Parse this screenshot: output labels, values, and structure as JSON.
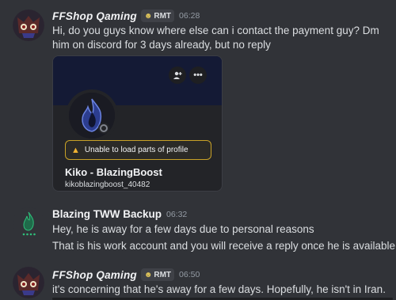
{
  "messages": [
    {
      "username": "FFShop Qaming",
      "tag": "RMT",
      "tag_icon": "emoji-icon",
      "time": "06:28",
      "lines": [
        "Hi, do you guys know where else can i contact the payment guy? Dm",
        "him on discord for 3 days already, but no reply"
      ]
    },
    {
      "username": "Blazing TWW Backup",
      "time": "06:32",
      "lines": [
        "Hey, he is away for a few days due to personal reasons",
        "That is his work account and you will receive a reply once he is available"
      ]
    },
    {
      "username": "FFShop Qaming",
      "tag": "RMT",
      "time": "06:50",
      "lines": [
        "it's concerning that he's away for a few days. Hopefully, he isn't in Iran."
      ]
    }
  ],
  "profile_card": {
    "warning": "Unable to load parts of profile",
    "display_name": "Kiko - BlazingBoost",
    "username": "kikoblazingboost_40482",
    "status": "offline",
    "banner_color": "#141a35",
    "add_friend_icon": "add-friend-icon",
    "more_icon": "more-options-icon",
    "more_glyph": "•••"
  },
  "colors": {
    "background": "#313338",
    "text": "#dbdee1",
    "muted": "#949ba4",
    "warning": "#f0b232"
  }
}
